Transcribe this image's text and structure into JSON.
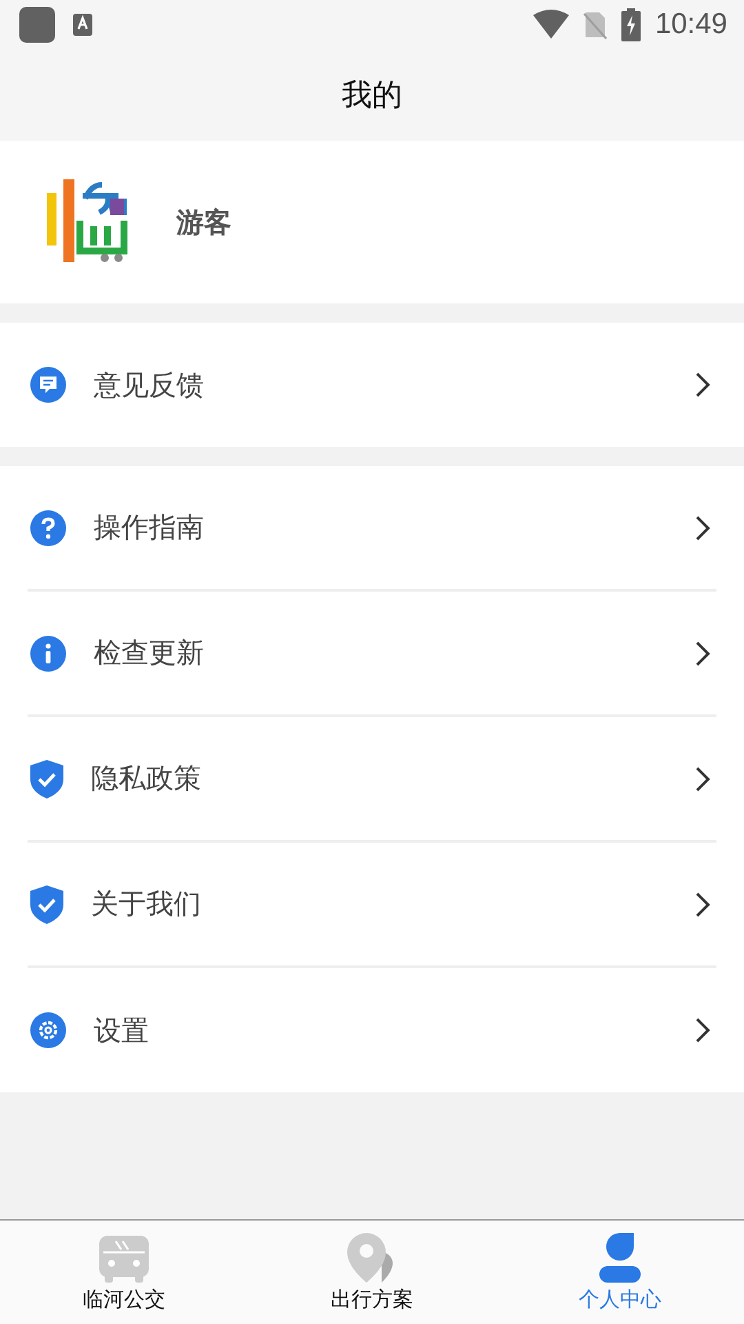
{
  "status_bar": {
    "time": "10:49"
  },
  "header": {
    "title": "我的"
  },
  "profile": {
    "name": "游客"
  },
  "menu_groups": [
    [
      {
        "label": "意见反馈",
        "kind": "feedback"
      }
    ],
    [
      {
        "label": "操作指南",
        "kind": "help"
      },
      {
        "label": "检查更新",
        "kind": "info"
      },
      {
        "label": "隐私政策",
        "kind": "shield"
      },
      {
        "label": "关于我们",
        "kind": "shield"
      },
      {
        "label": "设置",
        "kind": "settings"
      }
    ]
  ],
  "bottom_nav": [
    {
      "label": "临河公交",
      "kind": "bus",
      "selected": false
    },
    {
      "label": "出行方案",
      "kind": "route",
      "selected": false
    },
    {
      "label": "个人中心",
      "kind": "person",
      "selected": true
    }
  ]
}
